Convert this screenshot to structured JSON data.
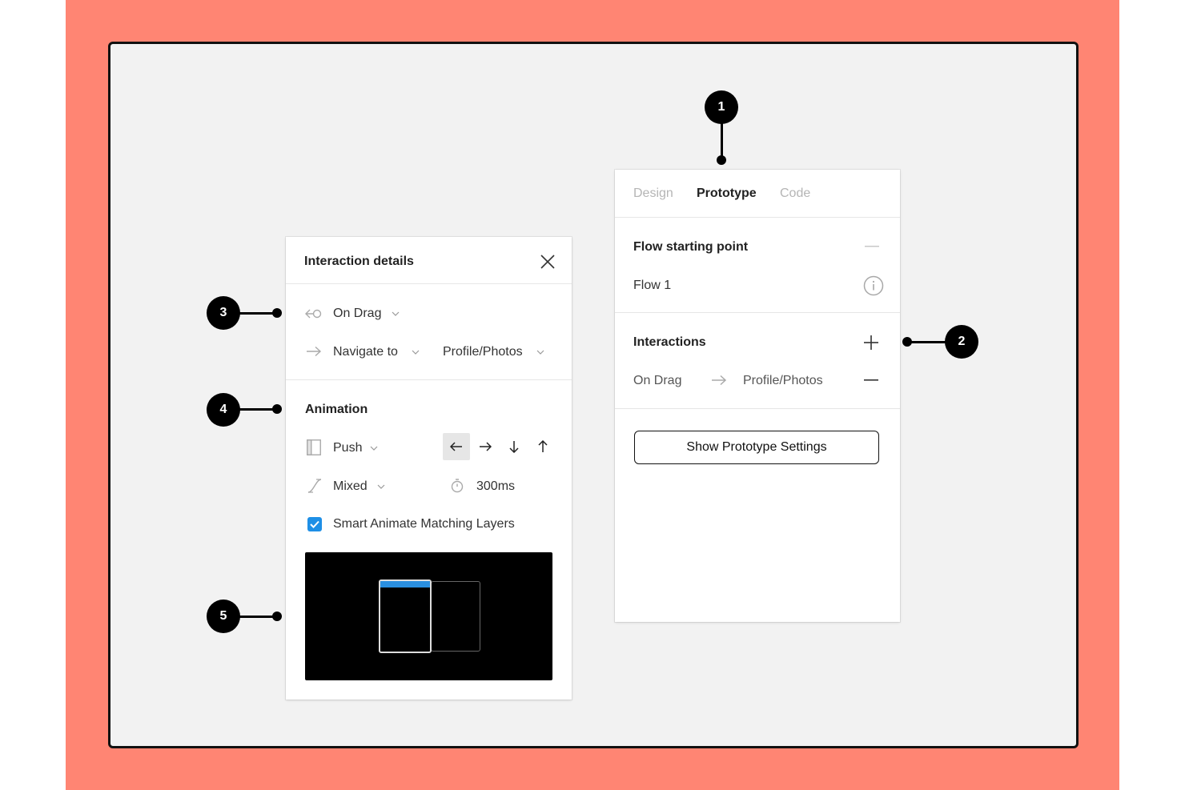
{
  "callouts": [
    "1",
    "2",
    "3",
    "4",
    "5"
  ],
  "tabs": {
    "design": "Design",
    "prototype": "Prototype",
    "code": "Code"
  },
  "flow": {
    "heading": "Flow starting point",
    "name": "Flow 1"
  },
  "interactions": {
    "heading": "Interactions",
    "trigger": "On Drag",
    "destination": "Profile/Photos"
  },
  "settings_button": "Show Prototype Settings",
  "details": {
    "title": "Interaction details",
    "trigger": "On Drag",
    "action": "Navigate to",
    "destination": "Profile/Photos",
    "animation_heading": "Animation",
    "animation_type": "Push",
    "easing": "Mixed",
    "duration": "300ms",
    "smart_animate": "Smart Animate Matching Layers"
  },
  "colors": {
    "background": "#ff8573",
    "canvas": "#f2f2f2",
    "accent": "#1e8fe6"
  }
}
